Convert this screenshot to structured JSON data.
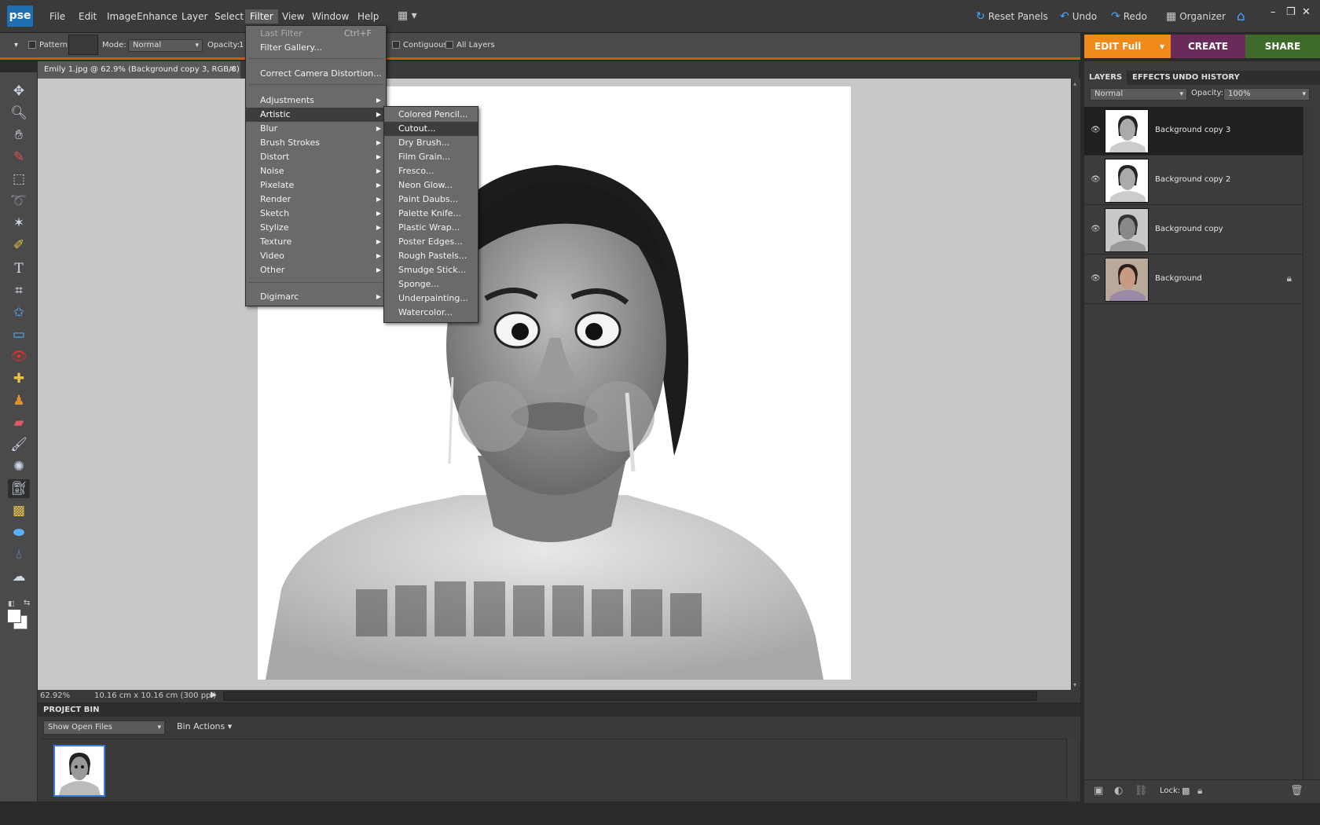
{
  "app": {
    "logo": "pse"
  },
  "menubar": {
    "items": [
      "File",
      "Edit",
      "Image",
      "Enhance",
      "Layer",
      "Select",
      "Filter",
      "View",
      "Window",
      "Help"
    ],
    "active": "Filter",
    "right": {
      "reset_panels": "Reset Panels",
      "undo": "Undo",
      "redo": "Redo",
      "organizer": "Organizer"
    }
  },
  "options": {
    "pattern_label": "Pattern",
    "mode_label": "Mode:",
    "mode_value": "Normal",
    "opacity_label": "Opacity:",
    "opacity_value": "1",
    "contiguous_label": "Contiguous",
    "all_layers_label": "All Layers"
  },
  "modes": {
    "edit": "EDIT Full",
    "create": "CREATE",
    "share": "SHARE",
    "edit_color": "#f08a1a",
    "create_color": "#6a2a5a",
    "share_color": "#3e6a2a"
  },
  "document": {
    "tab_title": "Emily 1.jpg @ 62.9% (Background copy 3, RGB/8) *"
  },
  "status": {
    "zoom": "62.92%",
    "doc_size": "10.16 cm x 10.16 cm (300 ppi)"
  },
  "project_bin": {
    "title": "PROJECT BIN",
    "show_select": "Show Open Files",
    "bin_actions": "Bin Actions"
  },
  "filter_menu": {
    "items": [
      {
        "label": "Last Filter",
        "shortcut": "Ctrl+F",
        "disabled": true
      },
      {
        "label": "Filter Gallery..."
      },
      {
        "label": "Correct Camera Distortion..."
      },
      {
        "label": "Adjustments",
        "submenu": true
      },
      {
        "label": "Artistic",
        "submenu": true,
        "highlighted": true
      },
      {
        "label": "Blur",
        "submenu": true
      },
      {
        "label": "Brush Strokes",
        "submenu": true
      },
      {
        "label": "Distort",
        "submenu": true
      },
      {
        "label": "Noise",
        "submenu": true
      },
      {
        "label": "Pixelate",
        "submenu": true
      },
      {
        "label": "Render",
        "submenu": true
      },
      {
        "label": "Sketch",
        "submenu": true
      },
      {
        "label": "Stylize",
        "submenu": true
      },
      {
        "label": "Texture",
        "submenu": true
      },
      {
        "label": "Video",
        "submenu": true
      },
      {
        "label": "Other",
        "submenu": true
      },
      {
        "label": "Digimarc",
        "submenu": true
      }
    ]
  },
  "artistic_submenu": {
    "items": [
      "Colored Pencil...",
      "Cutout...",
      "Dry Brush...",
      "Film Grain...",
      "Fresco...",
      "Neon Glow...",
      "Paint Daubs...",
      "Palette Knife...",
      "Plastic Wrap...",
      "Poster Edges...",
      "Rough Pastels...",
      "Smudge Stick...",
      "Sponge...",
      "Underpainting...",
      "Watercolor..."
    ],
    "highlighted": "Cutout..."
  },
  "layers_panel": {
    "tabs": [
      "LAYERS",
      "EFFECTS",
      "UNDO HISTORY"
    ],
    "blend_mode": "Normal",
    "opacity_label": "Opacity:",
    "opacity_value": "100%",
    "layers": [
      {
        "name": "Background copy 3",
        "selected": true
      },
      {
        "name": "Background copy 2"
      },
      {
        "name": "Background copy"
      },
      {
        "name": "Background",
        "locked": true
      }
    ],
    "lock_label": "Lock:"
  }
}
